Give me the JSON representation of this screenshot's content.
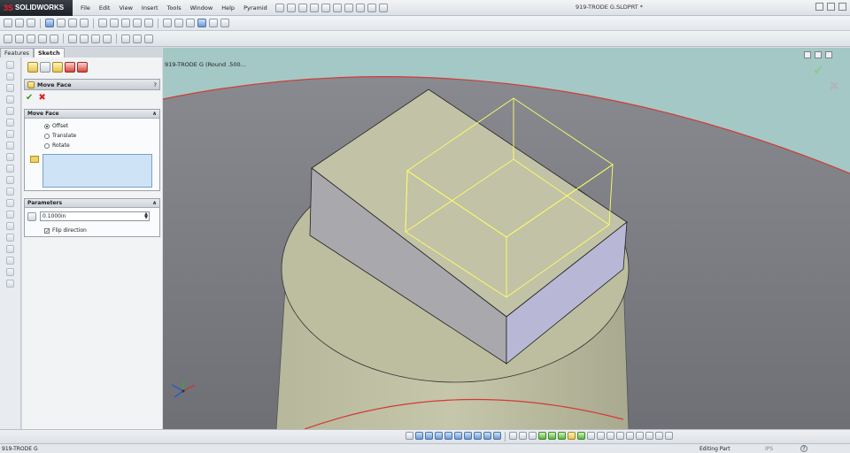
{
  "app": {
    "brand": "SOLIDWORKS",
    "brand_mark": "3S",
    "document_title": "919-TRODE G.SLDPRT *"
  },
  "menu": [
    "File",
    "Edit",
    "View",
    "Insert",
    "Tools",
    "Window",
    "Help",
    "Pyramid"
  ],
  "tabs": [
    {
      "label": "Features"
    },
    {
      "label": "Sketch"
    }
  ],
  "property_manager": {
    "title": "Move Face",
    "help": "?",
    "ok": "✔",
    "cancel": "✖",
    "move_face_group": {
      "title": "Move Face",
      "options": [
        {
          "label": "Offset",
          "selected": true
        },
        {
          "label": "Translate",
          "selected": false
        },
        {
          "label": "Rotate",
          "selected": false
        }
      ]
    },
    "parameters_group": {
      "title": "Parameters",
      "distance_value": "0.1000in",
      "flip_direction_label": "Flip direction",
      "flip_direction_checked": true
    }
  },
  "viewport": {
    "tree_label": "919-TRODE G  (Round .500...",
    "background_color": "#7e8087",
    "teal_color": "#a4c8c6",
    "cylinder_color": "#bdbda0",
    "block_side_color": "#a8a8ad",
    "block_front_color": "#b8b8d6",
    "preview_color": "#ffff66",
    "red_curve_color": "#d23a34"
  },
  "status": {
    "part_name": "919-TRODE G",
    "mode": "Editing Part",
    "units": "IPS",
    "help": "?"
  }
}
